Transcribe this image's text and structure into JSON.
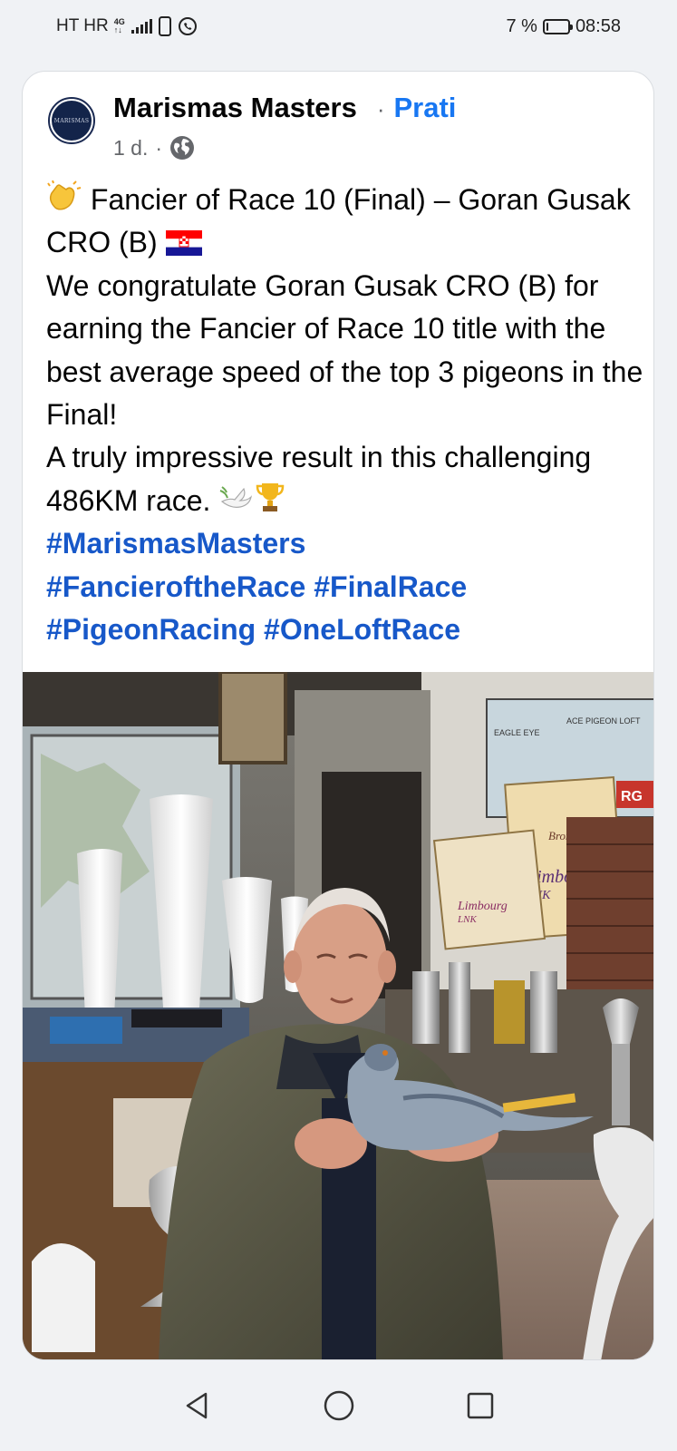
{
  "status_bar": {
    "carrier": "HT HR",
    "network": "4G",
    "battery_percent": "7 %",
    "battery_level": 0.07,
    "time": "08:58"
  },
  "post": {
    "page_name": "Marismas Masters",
    "avatar_text": "MARISMAS",
    "separator": "·",
    "follow_label": "Prati",
    "time_ago": "1 d.",
    "meta_separator": "·",
    "audience_icon": "globe-icon",
    "text": {
      "line1": "Fancier of Race 10 (Final) – Goran Gusak CRO (B)",
      "line2": "We congratulate Goran Gusak CRO (B) for earning the Fancier of Race 10 title with the best average speed of the top 3 pigeons in the Final!",
      "line3": "A truly impressive result in this challenging 486KM race.",
      "hashtags": [
        "#MarismasMasters",
        "#FancieroftheRace",
        "#FinalRace",
        "#PigeonRacing",
        "#OneLoftRace"
      ]
    },
    "photo": {
      "signs": {
        "eagle_eye": "EAGLE EYE",
        "ace_pigeon_loft": "ACE PIGEON LOFT",
        "rg": "RG",
        "bronzen_vleugel": "Bronzen Vleugel",
        "limbourg": "Limbourg",
        "limbourg_sub": "LNK",
        "limbourg_small": "Limbourg",
        "limbourg_small_sub": "LNK"
      }
    }
  },
  "nav": {
    "back_icon": "back-triangle-icon",
    "home_icon": "home-circle-icon",
    "recents_icon": "recents-square-icon"
  },
  "colors": {
    "link_blue": "#1877f2",
    "hashtag_blue": "#1758c9",
    "background": "#f0f2f5"
  }
}
